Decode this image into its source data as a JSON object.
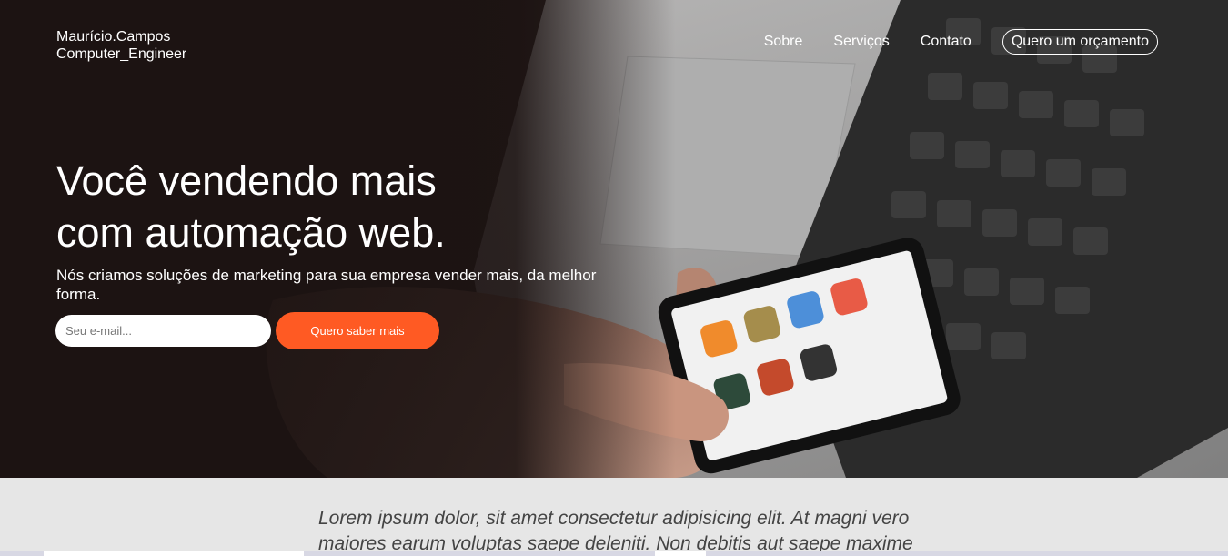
{
  "brand": {
    "line1": "Maurício.Campos",
    "line2": "Computer_Engineer"
  },
  "nav": {
    "items": [
      "Sobre",
      "Serviços",
      "Contato"
    ],
    "cta": "Quero um orçamento"
  },
  "hero": {
    "headline_line1": "Você vendendo mais",
    "headline_line2": "com automação web.",
    "subtitle": "Nós criamos soluções de marketing para sua empresa vender mais, da melhor forma.",
    "email_placeholder": "Seu e-mail...",
    "submit_label": "Quero saber mais",
    "image_description_icon": "laptop-phone-photo"
  },
  "intro": {
    "text": "Lorem ipsum dolor, sit amet consectetur adipisicing elit. At magni vero maiores earum voluptas saepe deleniti. Non debitis aut saepe maxime"
  },
  "colors": {
    "accent": "#ff5a23",
    "hero_dark": "#1b1212",
    "section_bg": "#e6e6e6"
  }
}
